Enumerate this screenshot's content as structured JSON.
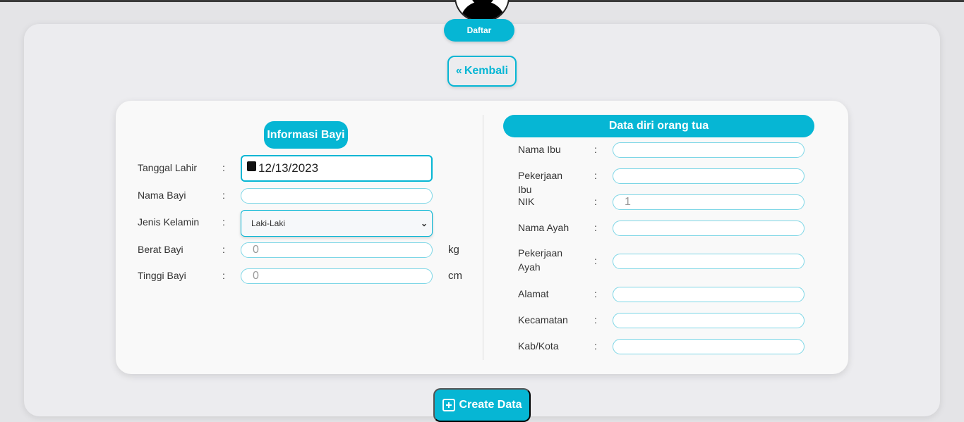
{
  "header": {
    "register_label": "Daftar",
    "back_label": "Kembali"
  },
  "baby": {
    "title": "Informasi Bayi",
    "birth_date_label": "Tanggal Lahir",
    "birth_date_value": "12/13/2023",
    "name_label": "Nama Bayi",
    "name_value": "",
    "gender_label": "Jenis Kelamin",
    "gender_value": "Laki-Laki",
    "weight_label": "Berat Bayi",
    "weight_value": "0",
    "weight_unit": "kg",
    "height_label": "Tinggi Bayi",
    "height_value": "0",
    "height_unit": "cm"
  },
  "parent": {
    "title": "Data diri orang tua",
    "fields": [
      {
        "label": "Nama Ibu",
        "value": ""
      },
      {
        "label": "Pekerjaan Ibu",
        "value": ""
      },
      {
        "label": "NIK",
        "value": "1"
      },
      {
        "label": "Nama Ayah",
        "value": ""
      },
      {
        "label": "Pekerjaan Ayah",
        "value": ""
      },
      {
        "label": "Alamat",
        "value": ""
      },
      {
        "label": "Kecamatan",
        "value": ""
      },
      {
        "label": "Kab/Kota",
        "value": ""
      }
    ]
  },
  "colon": ":",
  "create_label": "Create Data",
  "colors": {
    "accent": "#06b6d4"
  }
}
